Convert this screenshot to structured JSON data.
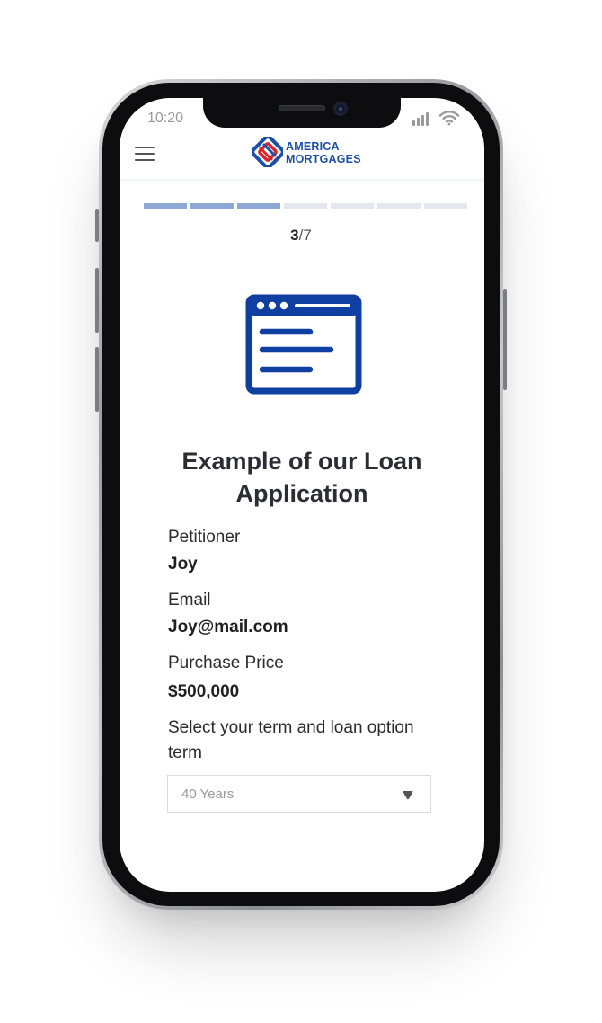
{
  "status_bar": {
    "time": "10:20"
  },
  "header": {
    "logo_line1": "AMERICA",
    "logo_line2": "MORTGAGES",
    "menu_icon": "hamburger-menu-icon"
  },
  "progress": {
    "current": "3",
    "total": "/7",
    "current_step": 3,
    "total_steps": 7,
    "complete_color": "#8fa9d6",
    "incomplete_color": "#e4e7ee"
  },
  "hero": {
    "icon": "browser-window-icon",
    "color": "#0f3fa0"
  },
  "main": {
    "title": "Example of our Loan Application",
    "fields": [
      {
        "label": "Petitioner",
        "value": "Joy"
      },
      {
        "label": "Email",
        "value": "Joy@mail.com"
      },
      {
        "label": "Purchase Price",
        "value": "$500,000"
      }
    ],
    "select_label": "Select your term and loan option term",
    "select_value": "40 Years"
  },
  "brand": {
    "blue": "#1e4fa8",
    "red": "#d8252f"
  }
}
